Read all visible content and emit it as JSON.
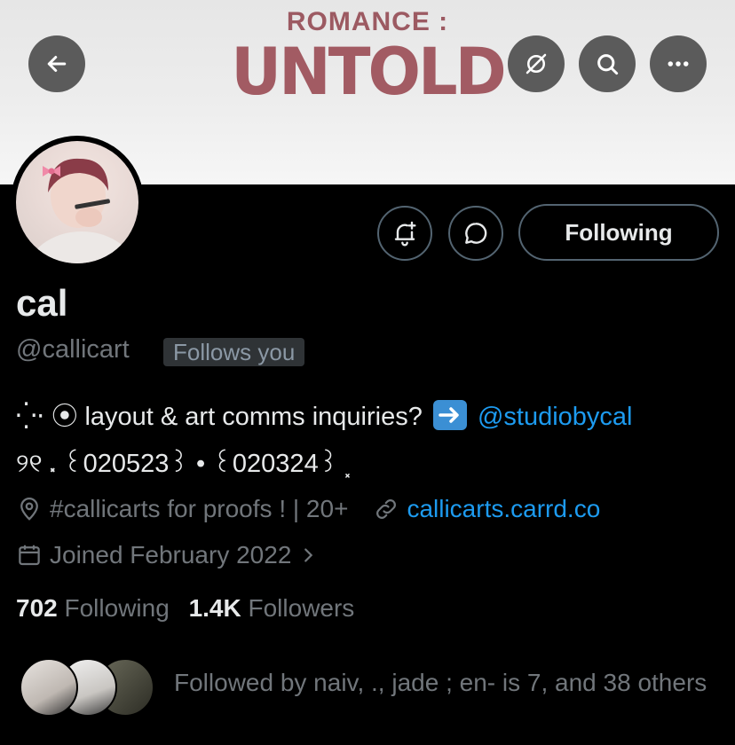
{
  "banner": {
    "subtitle": "ROMANCE :",
    "title": "UNTOLD"
  },
  "header": {
    "back_icon": "arrow-left-icon",
    "notifications_off_icon": "bell-slash-icon",
    "search_icon": "search-icon",
    "more_icon": "ellipsis-icon"
  },
  "actions": {
    "subscribe_icon": "bell-plus-icon",
    "message_icon": "chat-bubble-icon",
    "following_label": "Following"
  },
  "profile": {
    "name": "cal",
    "handle": "@callicart",
    "follows_you": "Follows you",
    "bio_line1_prefix": "⁛⋅ ⦿ layout & art comms inquiries?",
    "bio_line1_link": "@studiobycal",
    "bio_line2": "୨୧ ⸼ ꒰020523꒱ • ꒰020324꒱ ⸼",
    "location": "#callicarts for proofs ! | 20+",
    "website": "callicarts.carrd.co",
    "joined": "Joined February 2022"
  },
  "stats": {
    "following_count": "702",
    "following_label": "Following",
    "followers_count": "1.4K",
    "followers_label": "Followers"
  },
  "followed_by": {
    "text": "Followed by naiv, ., jade ; en- is 7, and 38 others"
  },
  "colors": {
    "accent": "#1d9bf0",
    "banner_title": "#a25b63",
    "muted": "#71767b"
  }
}
